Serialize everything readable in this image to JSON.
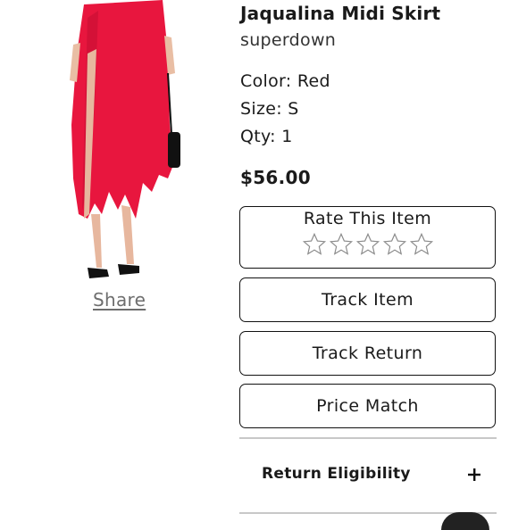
{
  "product": {
    "title": "Jaqualina Midi Skirt",
    "brand": "superdown",
    "color": "Color: Red",
    "size": "Size: S",
    "qty": "Qty: 1",
    "price": "$56.00",
    "image": "red-midi-skirt-photo"
  },
  "share": {
    "label": "Share"
  },
  "rating": {
    "title": "Rate This Item",
    "stars_max": 5,
    "stars_selected": 0
  },
  "actions": {
    "track_item": "Track Item",
    "track_return": "Track Return",
    "price_match": "Price Match"
  },
  "accordion": {
    "return_eligibility": "Return Eligibility",
    "icon": "plus-icon"
  },
  "colors": {
    "skirt": "#e8163e",
    "border": "#111111",
    "divider": "#c8c8c8",
    "share_text": "#6e6e6e"
  }
}
